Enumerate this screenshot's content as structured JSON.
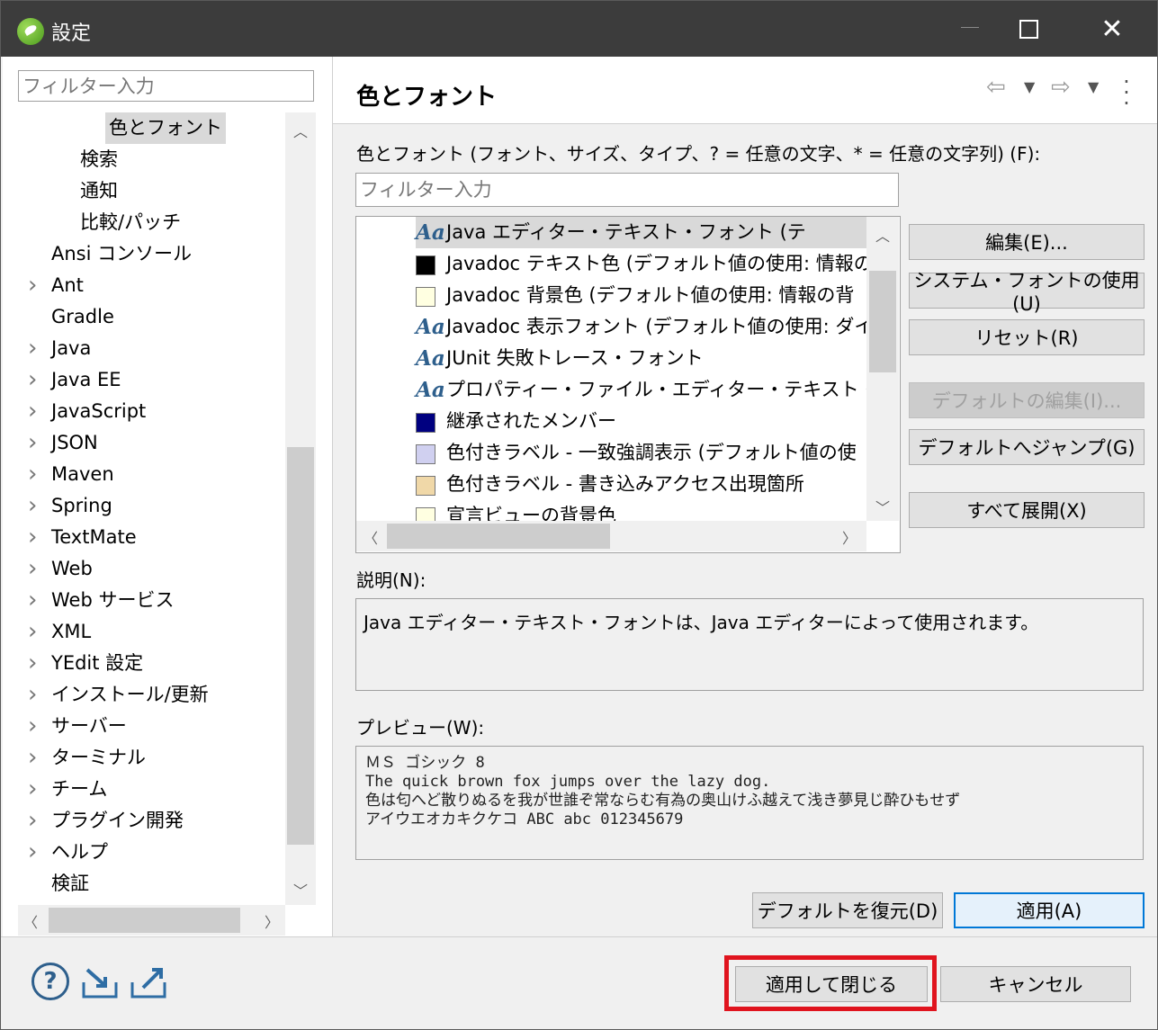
{
  "window": {
    "title": "設定"
  },
  "left": {
    "filter_placeholder": "フィルター入力",
    "tree": [
      {
        "label": "色とフォント",
        "indent": 2,
        "expandable": false,
        "selected": true
      },
      {
        "label": "検索",
        "indent": 1,
        "expandable": false
      },
      {
        "label": "通知",
        "indent": 1,
        "expandable": false
      },
      {
        "label": "比較/パッチ",
        "indent": 1,
        "expandable": false
      },
      {
        "label": "Ansi コンソール",
        "indent": 0,
        "expandable": false
      },
      {
        "label": "Ant",
        "indent": 0,
        "expandable": true
      },
      {
        "label": "Gradle",
        "indent": 0,
        "expandable": false
      },
      {
        "label": "Java",
        "indent": 0,
        "expandable": true
      },
      {
        "label": "Java EE",
        "indent": 0,
        "expandable": true
      },
      {
        "label": "JavaScript",
        "indent": 0,
        "expandable": true
      },
      {
        "label": "JSON",
        "indent": 0,
        "expandable": true
      },
      {
        "label": "Maven",
        "indent": 0,
        "expandable": true
      },
      {
        "label": "Spring",
        "indent": 0,
        "expandable": true
      },
      {
        "label": "TextMate",
        "indent": 0,
        "expandable": true
      },
      {
        "label": "Web",
        "indent": 0,
        "expandable": true
      },
      {
        "label": "Web サービス",
        "indent": 0,
        "expandable": true
      },
      {
        "label": "XML",
        "indent": 0,
        "expandable": true
      },
      {
        "label": "YEdit 設定",
        "indent": 0,
        "expandable": true
      },
      {
        "label": "インストール/更新",
        "indent": 0,
        "expandable": true
      },
      {
        "label": "サーバー",
        "indent": 0,
        "expandable": true
      },
      {
        "label": "ターミナル",
        "indent": 0,
        "expandable": true
      },
      {
        "label": "チーム",
        "indent": 0,
        "expandable": true
      },
      {
        "label": "プラグイン開発",
        "indent": 0,
        "expandable": true
      },
      {
        "label": "ヘルプ",
        "indent": 0,
        "expandable": true
      },
      {
        "label": "検証",
        "indent": 0,
        "expandable": false
      }
    ]
  },
  "right": {
    "title": "色とフォント",
    "list_label": "色とフォント (フォント、サイズ、タイプ、? = 任意の文字、* = 任意の文字列) (F):",
    "filter_placeholder": "フィルター入力",
    "font_items": [
      {
        "type": "font",
        "label": "Java エディター・テキスト・フォント (テ",
        "selected": true
      },
      {
        "type": "color",
        "color": "#000000",
        "label": "Javadoc テキスト色 (デフォルト値の使用: 情報の"
      },
      {
        "type": "color",
        "color": "#ffffe1",
        "label": "Javadoc 背景色 (デフォルト値の使用: 情報の背"
      },
      {
        "type": "font",
        "label": "Javadoc 表示フォント (デフォルト値の使用: ダイア"
      },
      {
        "type": "font",
        "label": "JUnit 失敗トレース・フォント"
      },
      {
        "type": "font",
        "label": "プロパティー・ファイル・エディター・テキスト・フォント (デフ"
      },
      {
        "type": "color",
        "color": "#000080",
        "label": "継承されたメンバー"
      },
      {
        "type": "color",
        "color": "#d0d0f0",
        "label": "色付きラベル - 一致強調表示 (デフォルト値の使"
      },
      {
        "type": "color",
        "color": "#f0d8a8",
        "label": "色付きラベル - 書き込みアクセス出現箇所"
      },
      {
        "type": "color",
        "color": "#ffffe1",
        "label": "宣言ビューの背景色"
      }
    ],
    "buttons": {
      "edit": "編集(E)...",
      "system_font": "システム・フォントの使用(U)",
      "reset": "リセット(R)",
      "edit_default": "デフォルトの編集(I)...",
      "goto_default": "デフォルトへジャンプ(G)",
      "expand_all": "すべて展開(X)",
      "restore_defaults": "デフォルトを復元(D)",
      "apply": "適用(A)"
    },
    "description_label": "説明(N):",
    "description": "Java エディター・テキスト・フォントは、Java エディターによって使用されます。",
    "preview_label": "プレビュー(W):",
    "preview_lines": [
      "ＭＳ ゴシック 8",
      "The quick brown fox jumps over the lazy dog.",
      "色は匂へど散りぬるを我が世誰ぞ常ならむ有為の奥山けふ越えて浅き夢見じ酔ひもせず",
      "アイウエオカキクケコ ABC abc 012345679"
    ]
  },
  "footer": {
    "apply_close": "適用して閉じる",
    "cancel": "キャンセル"
  },
  "colors": {
    "accent": "#0078d7",
    "highlight": "#e0141e",
    "titlebar": "#3c3c3c"
  }
}
